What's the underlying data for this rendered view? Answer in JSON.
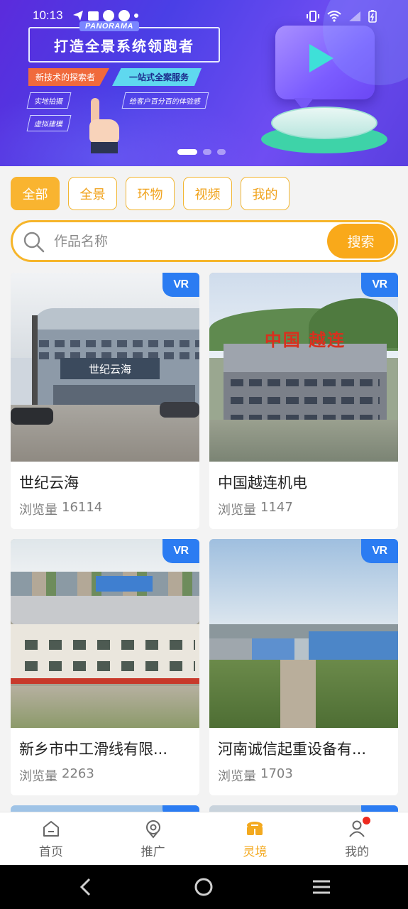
{
  "status_bar": {
    "time": "10:13"
  },
  "banner": {
    "brand_tag": "PANORAMA",
    "title": "打造全景系统领跑者",
    "tag_left": "新技术的探索者",
    "tag_right": "一站式全案服务",
    "sub_tags": [
      "实地拍摄",
      "给客户百分百的体验感",
      "虚拟建模"
    ],
    "carousel_count": 3,
    "carousel_active": 1
  },
  "filters": [
    {
      "label": "全部",
      "active": true
    },
    {
      "label": "全景",
      "active": false
    },
    {
      "label": "环物",
      "active": false
    },
    {
      "label": "视频",
      "active": false
    },
    {
      "label": "我的",
      "active": false
    }
  ],
  "search": {
    "placeholder": "作品名称",
    "button_label": "搜索"
  },
  "works": [
    {
      "title": "世纪云海",
      "views_label": "浏览量",
      "views": "16114",
      "badge": "VR"
    },
    {
      "title": "中国越连机电",
      "views_label": "浏览量",
      "views": "1147",
      "badge": "VR"
    },
    {
      "title": "新乡市中工滑线有限...",
      "views_label": "浏览量",
      "views": "2263",
      "badge": "VR"
    },
    {
      "title": "河南诚信起重设备有...",
      "views_label": "浏览量",
      "views": "1703",
      "badge": "VR"
    }
  ],
  "thumb_text": {
    "card1_sign": "世纪云海",
    "card2_sign": "中国 越连"
  },
  "bottom_nav": [
    {
      "label": "首页",
      "icon": "home-icon",
      "active": false
    },
    {
      "label": "推广",
      "icon": "promote-icon",
      "active": false
    },
    {
      "label": "灵境",
      "icon": "lingjing-icon",
      "active": true
    },
    {
      "label": "我的",
      "icon": "user-icon",
      "active": false,
      "notification": true
    }
  ],
  "colors": {
    "accent": "#f9b430",
    "vr_badge": "#2b7cf2",
    "notification": "#ee2a1f",
    "banner": "#5b2bdc"
  }
}
